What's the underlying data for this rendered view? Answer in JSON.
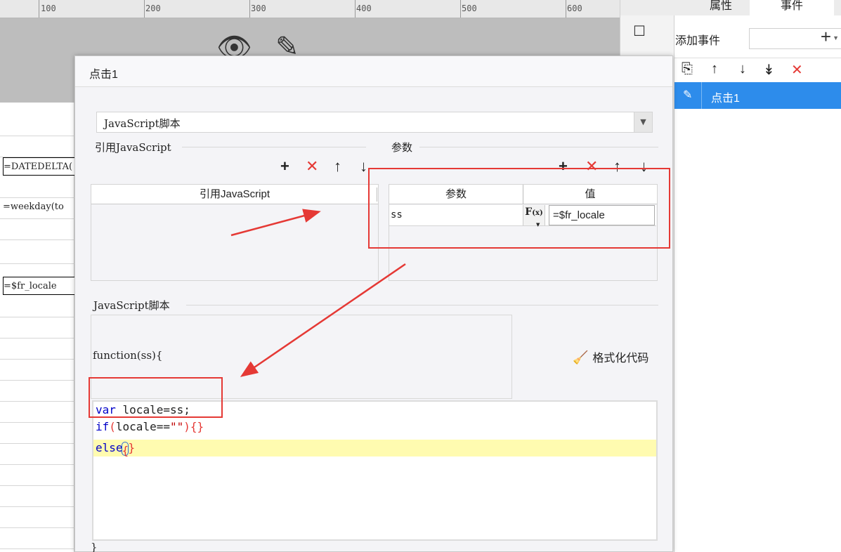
{
  "ruler": {
    "ticks": [
      "100",
      "200",
      "300",
      "400",
      "500",
      "600"
    ]
  },
  "sheet": {
    "formulas": [
      "=DATEDELTA(",
      "=weekday(to",
      "=$fr_locale"
    ]
  },
  "right_panel": {
    "tabs": [
      "属性",
      "事件"
    ],
    "add_event_label": "添加事件",
    "event_item": "点击1"
  },
  "dialog": {
    "title": "点击1",
    "type_value": "JavaScript脚本",
    "ref_section_title": "引用JavaScript",
    "ref_table_header": "引用JavaScript",
    "params_section_title": "参数",
    "params_headers": [
      "参数",
      "值"
    ],
    "params_rows": [
      {
        "name": "ss",
        "fx_label": "F",
        "fx_sub": "(x)",
        "value": "=$fr_locale"
      }
    ],
    "script_section_title": "JavaScript脚本",
    "function_signature": "function(ss){",
    "format_button": "格式化代码",
    "code": {
      "line1_kw": "var",
      "line1_rest": " locale=ss;",
      "line2_kw": "if",
      "line2_paren_open": "(",
      "line2_mid": "locale==",
      "line2_str": "\"\"",
      "line2_close": "){}",
      "line3_kw": "else",
      "line3_open": "{",
      "line3_close": "}"
    },
    "closing_brace": "}"
  },
  "colors": {
    "accent": "#2d8ceb",
    "annotation": "#e53935",
    "highlight": "#fffbb0",
    "keyword": "#0000c8"
  }
}
